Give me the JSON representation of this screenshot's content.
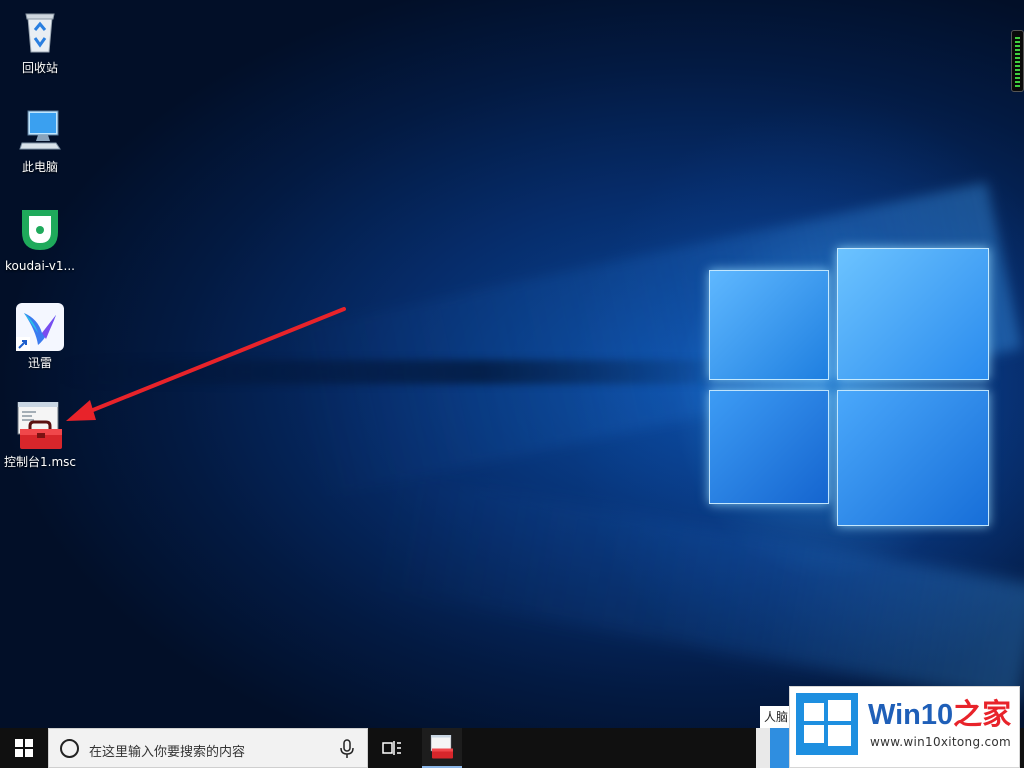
{
  "desktop": {
    "icons": [
      {
        "label": "回收站",
        "icon": "recycle-bin-icon"
      },
      {
        "label": "此电脑",
        "icon": "this-pc-icon"
      },
      {
        "label": "koudai-v1...",
        "icon": "koudai-app-icon"
      },
      {
        "label": "迅雷",
        "icon": "xunlei-thunder-icon",
        "shortcut": true
      },
      {
        "label": "控制台1.msc",
        "icon": "mmc-console-icon"
      }
    ]
  },
  "taskbar": {
    "search_placeholder": "在这里输入你要搜索的内容",
    "pinned": [
      "task-view-icon",
      "mmc-console-icon"
    ]
  },
  "watermark": {
    "hint": "人脑",
    "brand_main": "Win10",
    "brand_accent": "之家",
    "url": "www.win10xitong.com"
  },
  "colors": {
    "taskbar": "#101010",
    "arrow": "#e8232a",
    "brand_blue": "#1f5fb8",
    "brand_red": "#e8232a"
  }
}
